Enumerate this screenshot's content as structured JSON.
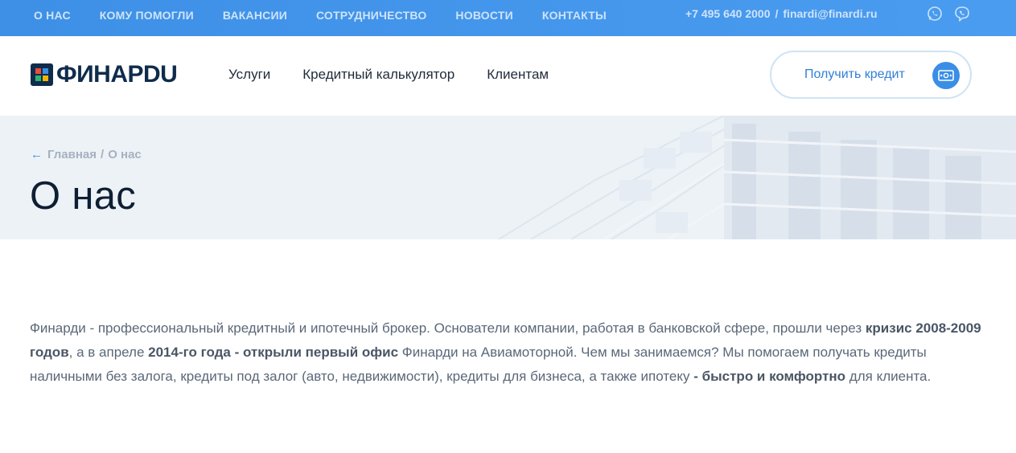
{
  "topbar": {
    "nav": [
      "О НАС",
      "КОМУ ПОМОГЛИ",
      "ВАКАНСИИ",
      "СОТРУДНИЧЕСТВО",
      "НОВОСТИ",
      "КОНТАКТЫ"
    ],
    "phone": "+7 495 640 2000",
    "separator": "/",
    "email": "finardi@finardi.ru",
    "icons": [
      "whatsapp-icon",
      "viber-icon"
    ]
  },
  "header": {
    "logo_text": "ФИНАРDU",
    "nav": [
      "Услуги",
      "Кредитный калькулятор",
      "Клиентам"
    ],
    "cta_label": "Получить кредит",
    "cta_icon": "money-icon"
  },
  "hero": {
    "breadcrumb_home": "Главная",
    "breadcrumb_sep": "/",
    "breadcrumb_current": "О нас",
    "title": "О нас"
  },
  "content": {
    "p1": "Финарди - профессиональный кредитный и ипотечный брокер. Основатели компании, работая в банковской сфере, прошли через ",
    "b1": "кризис 2008-2009 годов",
    "p2": ", а в апреле ",
    "b2": "2014-го года - открыли первый офис",
    "p3": " Финарди на Авиамоторной. Чем мы занимаемся? Мы помогаем получать кредиты наличными без залога, кредиты под залог (авто, недвижимости), кредиты для бизнеса, а также ипотеку ",
    "b3": "- быстро и комфортно",
    "p4": " для клиента."
  },
  "colors": {
    "topbar": "#4a9cf0",
    "accent": "#3a8ee6",
    "title": "#0f1f33",
    "text": "#5b6878",
    "hero_bg": "#edf2f7"
  }
}
